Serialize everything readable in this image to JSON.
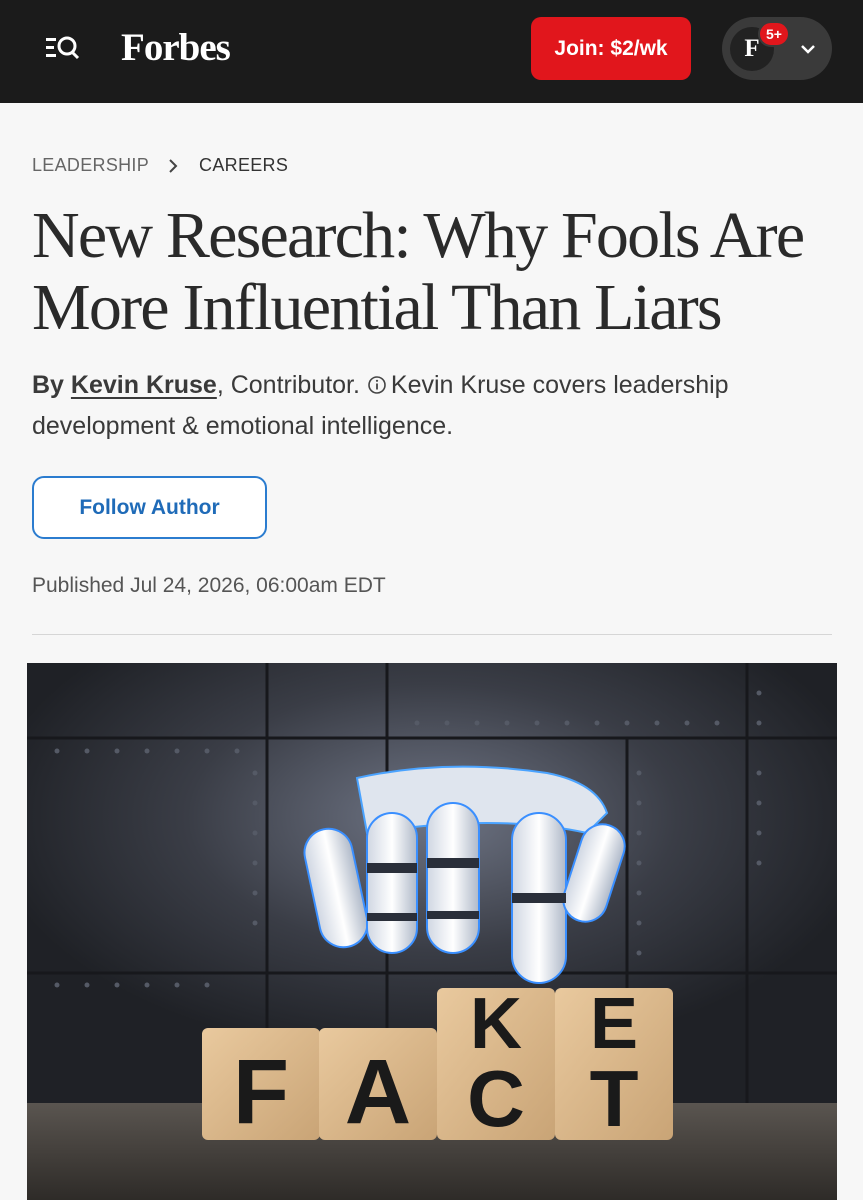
{
  "header": {
    "logo": "Forbes",
    "join_label": "Join: $2/wk",
    "avatar_initial": "F",
    "notification_badge": "5+"
  },
  "breadcrumb": {
    "items": [
      "LEADERSHIP",
      "CAREERS"
    ]
  },
  "article": {
    "headline": "New Research: Why Fools Are More Influential Than Liars",
    "byline_prefix": "By",
    "author": "Kevin Kruse",
    "role": ", Contributor.",
    "author_bio": "Kevin Kruse covers leadership development & emotional intelligence.",
    "follow_label": "Follow Author",
    "published": "Published Jul 24, 2026, 06:00am EDT"
  },
  "hero_image": {
    "cube_letters_front": [
      "F",
      "A",
      "C",
      "T"
    ],
    "cube_letters_top": [
      "K",
      "E"
    ]
  },
  "colors": {
    "header_bg": "#1b1b1b",
    "join_red": "#e1161c",
    "follow_blue": "#1f6bb8"
  }
}
